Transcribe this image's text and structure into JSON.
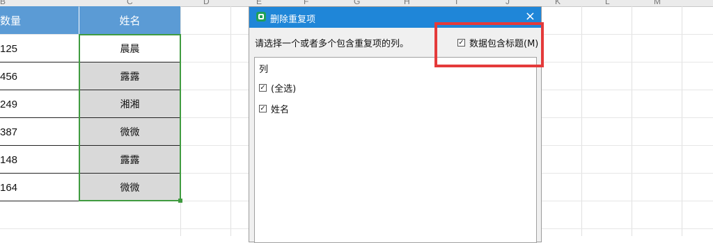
{
  "sheet": {
    "column_letters": [
      "B",
      "C",
      "D",
      "E",
      "F",
      "G",
      "H",
      "I",
      "J",
      "K",
      "L",
      "M"
    ],
    "header_qty": "数量",
    "header_name": "姓名",
    "rows": [
      {
        "qty": "125",
        "name": "晨晨"
      },
      {
        "qty": "456",
        "name": "露露"
      },
      {
        "qty": "249",
        "name": "湘湘"
      },
      {
        "qty": "387",
        "name": "微微"
      },
      {
        "qty": "148",
        "name": "露露"
      },
      {
        "qty": "164",
        "name": "微微"
      }
    ]
  },
  "dialog": {
    "title": "删除重复项",
    "close_glyph": "×",
    "prompt": "请选择一个或者多个包含重复项的列。",
    "header_option_label": "数据包含标题(M)",
    "header_option_checked": true,
    "list_header": "列",
    "items": [
      {
        "label": "(全选)",
        "checked": true
      },
      {
        "label": "姓名",
        "checked": true
      }
    ]
  },
  "colors": {
    "header_fill": "#5b9bd5",
    "selected_fill": "#d9d9d9",
    "selection_border": "#3f9b3f",
    "titlebar": "#1f86d8",
    "highlight": "#e43a3a"
  }
}
